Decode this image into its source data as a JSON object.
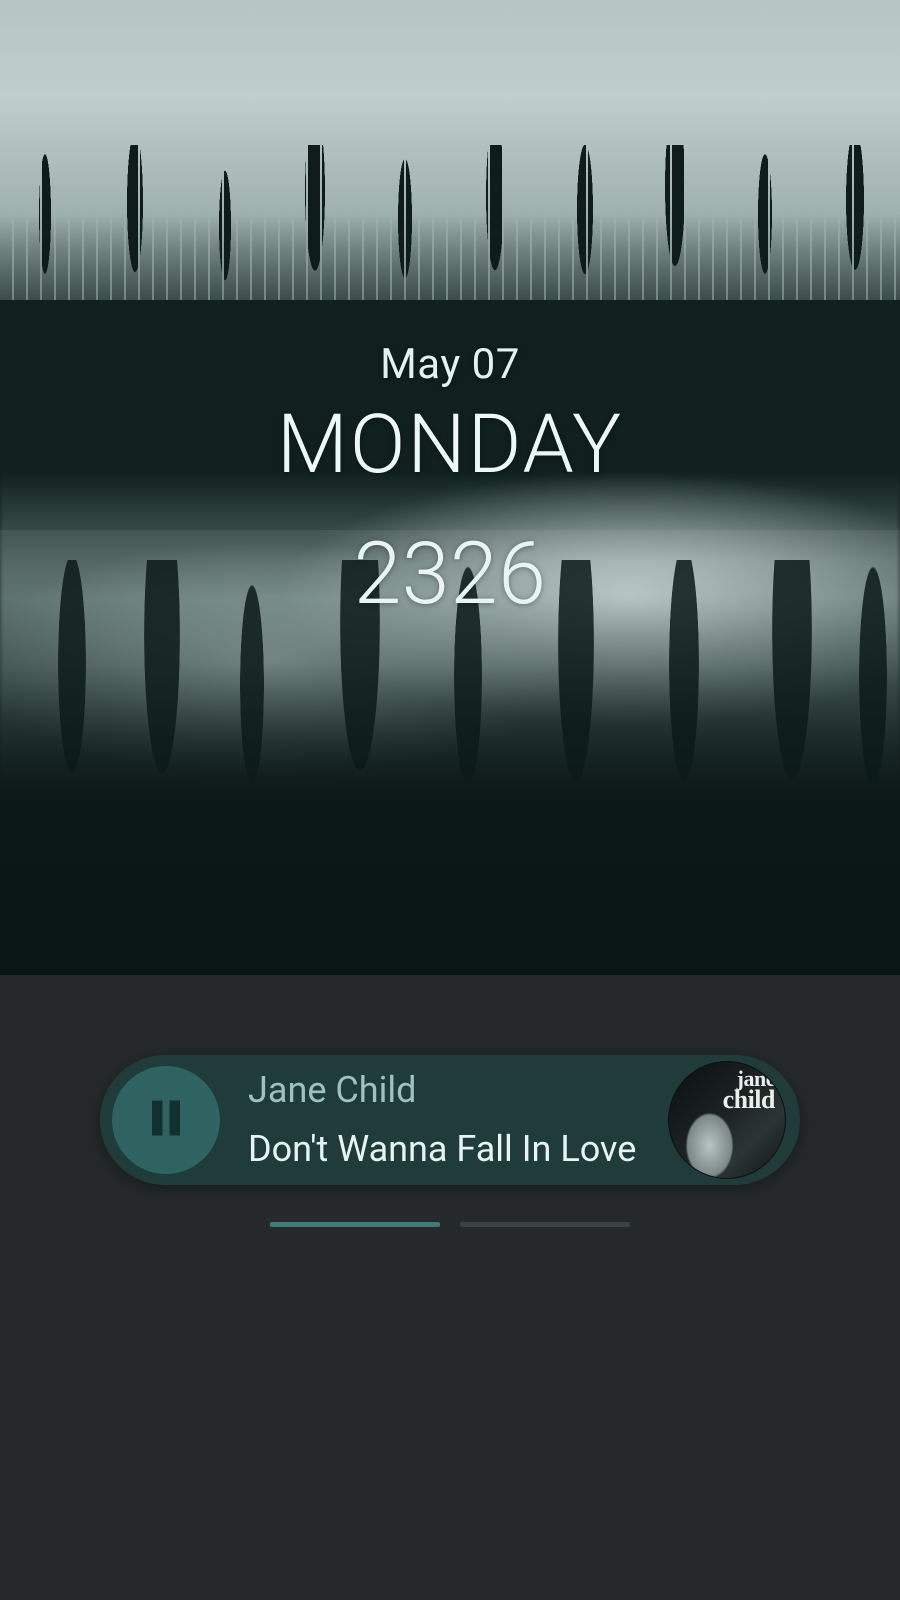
{
  "clock": {
    "date": "May 07",
    "day": "MONDAY",
    "time": "2326"
  },
  "music": {
    "artist": "Jane Child",
    "title": "Don't Wanna Fall In Love",
    "album_art_text_line1": "jane",
    "album_art_text_line2": "Child",
    "playing": true,
    "icon": "pause-icon"
  },
  "pager": {
    "pages": 2,
    "active_index": 0
  },
  "colors": {
    "widget_bg": "#1f3c3b",
    "accent": "#2f6361",
    "text_light": "#e6f4f1",
    "panel_bg": "#252929"
  }
}
